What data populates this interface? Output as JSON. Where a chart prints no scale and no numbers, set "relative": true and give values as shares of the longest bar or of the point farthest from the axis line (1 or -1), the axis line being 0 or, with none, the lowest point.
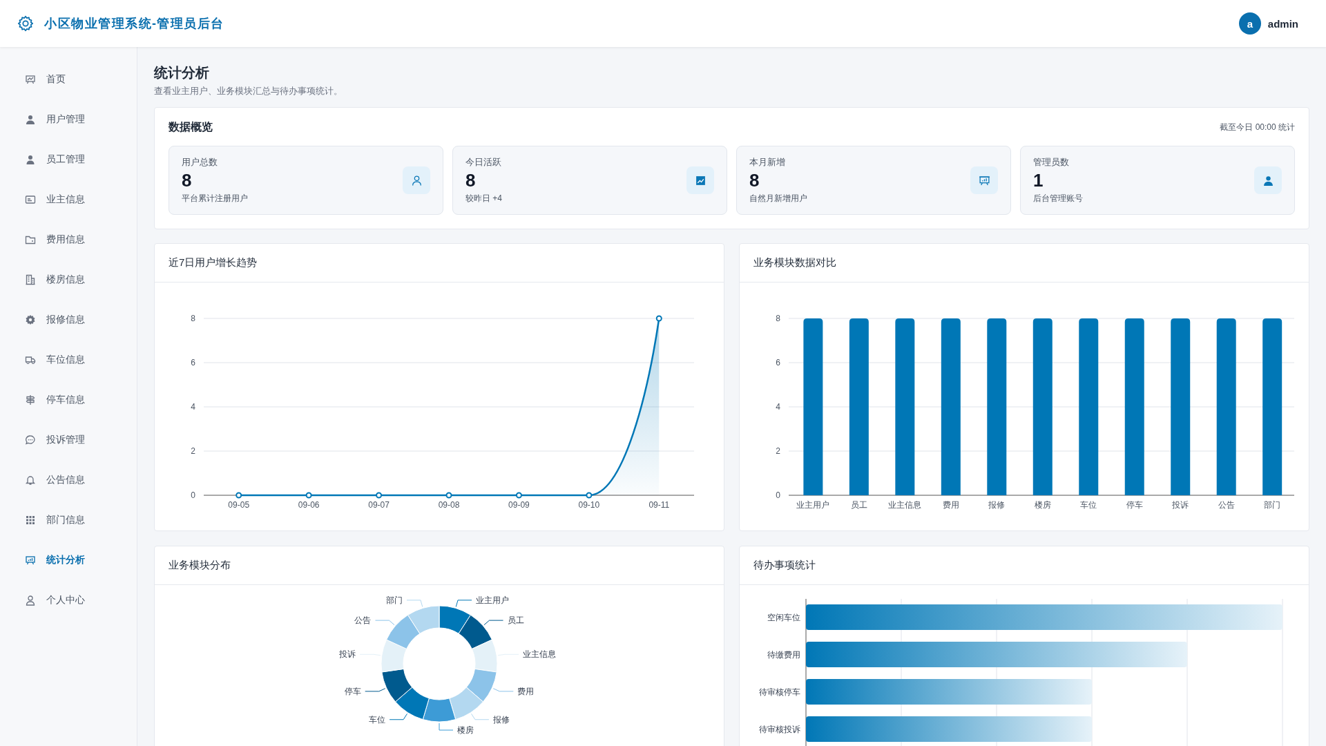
{
  "header": {
    "title": "小区物业管理系统-管理员后台",
    "user": {
      "avatar": "a",
      "name": "admin"
    }
  },
  "sidebar": {
    "items": [
      {
        "label": "首页",
        "selected": false
      },
      {
        "label": "用户管理",
        "selected": false
      },
      {
        "label": "员工管理",
        "selected": false
      },
      {
        "label": "业主信息",
        "selected": false
      },
      {
        "label": "费用信息",
        "selected": false
      },
      {
        "label": "楼房信息",
        "selected": false
      },
      {
        "label": "报修信息",
        "selected": false
      },
      {
        "label": "车位信息",
        "selected": false
      },
      {
        "label": "停车信息",
        "selected": false
      },
      {
        "label": "投诉管理",
        "selected": false
      },
      {
        "label": "公告信息",
        "selected": false
      },
      {
        "label": "部门信息",
        "selected": false
      },
      {
        "label": "统计分析",
        "selected": true
      },
      {
        "label": "个人中心",
        "selected": false
      }
    ]
  },
  "page": {
    "title": "统计分析",
    "subtitle": "查看业主用户、业务模块汇总与待办事项统计。"
  },
  "overview": {
    "title": "数据概览",
    "note": "截至今日 00:00 统计",
    "cards": [
      {
        "label": "用户总数",
        "value": "8",
        "caption": "平台累计注册用户"
      },
      {
        "label": "今日活跃",
        "value": "8",
        "caption": "较昨日 +4"
      },
      {
        "label": "本月新增",
        "value": "8",
        "caption": "自然月新增用户"
      },
      {
        "label": "管理员数",
        "value": "1",
        "caption": "后台管理账号"
      }
    ]
  },
  "panels": [
    {
      "title": "近7日用户增长趋势",
      "chart_data": {
        "type": "line",
        "x": [
          "09-05",
          "09-06",
          "09-07",
          "09-08",
          "09-09",
          "09-10",
          "09-11"
        ],
        "series": [
          {
            "color": "#0077b6",
            "marker": true,
            "values": [
              0,
              0,
              0,
              0,
              0,
              0,
              8
            ]
          }
        ],
        "ylim": [
          0,
          8
        ],
        "yticks": [
          0,
          2,
          4,
          6,
          8
        ],
        "grid": true
      }
    },
    {
      "title": "业务模块数据对比",
      "chart_data": {
        "type": "bar",
        "categories": [
          "业主用户",
          "员工",
          "业主信息",
          "费用",
          "报修",
          "楼房",
          "车位",
          "停车",
          "投诉",
          "公告",
          "部门"
        ],
        "series": [
          {
            "color": "#0077b6",
            "values": [
              8,
              8,
              8,
              8,
              8,
              8,
              8,
              8,
              8,
              8,
              8
            ]
          }
        ],
        "ylim": [
          0,
          8
        ],
        "yticks": [
          0,
          2,
          4,
          6,
          8
        ],
        "grid": true
      }
    },
    {
      "title": "业务模块分布",
      "chart_data": {
        "type": "donut",
        "categories": [
          "业主用户",
          "员工",
          "业主信息",
          "费用",
          "报修",
          "楼房",
          "车位",
          "停车",
          "投诉",
          "公告",
          "部门"
        ],
        "values": [
          9.09,
          9.09,
          9.09,
          9.09,
          9.09,
          9.1,
          9.09,
          9.09,
          9.09,
          9.09,
          9.09
        ]
      }
    },
    {
      "title": "待办事项统计",
      "chart_data": {
        "type": "bar",
        "orientation": "horizontal",
        "categories": [
          "空闲车位",
          "待缴费用",
          "待审核停车",
          "待审核投诉"
        ],
        "series": [
          {
            "color": "#0077b6",
            "values": [
              1,
              0.8,
              0.6,
              0.6
            ]
          }
        ],
        "relative": true
      }
    }
  ]
}
